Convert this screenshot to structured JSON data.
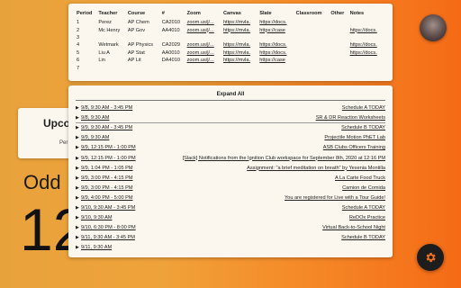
{
  "background": {
    "card_title": "Upco",
    "card_sub": "Per",
    "odd_label": "Odd",
    "big_number": "12"
  },
  "icons": {
    "avatar": "user-avatar",
    "settings": "gear-icon"
  },
  "colors": {
    "gear": "#f07020"
  },
  "schedule": {
    "headers": [
      "Period",
      "Teacher",
      "Course",
      "#",
      "Zoom",
      "Canvas",
      "Slate",
      "Classroom",
      "Other",
      "Notes"
    ],
    "rows": [
      [
        "1",
        "Perez",
        "AP Chem",
        "CA2010",
        "zoom.us/j/...",
        "https://mvla.",
        "https://docs.",
        "",
        "",
        ""
      ],
      [
        "2",
        "Mc Henry",
        "AP Gov",
        "AA4010",
        "zoom.us/j/...",
        "https://mvla.",
        "https://case",
        "",
        "",
        "https://docs."
      ],
      [
        "3",
        "",
        "",
        "",
        "",
        "",
        "",
        "",
        "",
        ""
      ],
      [
        "4",
        "Wetmark",
        "AP Physics",
        "CA2029",
        "zoom.us/j/...",
        "https://mvla.",
        "https://docs.",
        "",
        "",
        "https://docs."
      ],
      [
        "5",
        "Liu A",
        "AP Stat",
        "AA0010",
        "zoom.us/j/...",
        "https://mvla.",
        "https://docs.",
        "",
        "",
        "https://docs."
      ],
      [
        "6",
        "Lin",
        "AP Lit",
        "DA4010",
        "zoom.us/j/...",
        "https://mvla.",
        "https://case",
        "",
        "",
        ""
      ],
      [
        "7",
        "",
        "",
        "",
        "",
        "",
        "",
        "",
        "",
        ""
      ]
    ]
  },
  "events": {
    "expand_all": "Expand All",
    "items": [
      {
        "time": "9/8, 9:30 AM - 3:45 PM",
        "title": "Schedule A TODAY",
        "sep": false
      },
      {
        "time": "9/8, 9:30 AM",
        "title": "SR & DR Reaction Worksheets",
        "sep": true
      },
      {
        "time": "9/9, 9:30 AM - 3:45 PM",
        "title": "Schedule B TODAY",
        "sep": false
      },
      {
        "time": "9/9, 9:30 AM",
        "title": "Projectile Motion PhET Lab",
        "sep": false
      },
      {
        "time": "9/9, 12:15 PM - 1:00 PM",
        "title": "ASB Clubs Officers Training",
        "sep": false
      },
      {
        "time": "9/9, 12:15 PM - 1:00 PM",
        "title": "[Slack] Notifications from the Ignition Club workspace for September 8th, 2020 at 12:16 PM",
        "sep": false
      },
      {
        "time": "9/9, 1:04 PM - 1:05 PM",
        "title": "Assignment: \"a brief meditation on breath\" by Yesenia Montilla",
        "sep": false
      },
      {
        "time": "9/9, 3:00 PM - 4:15 PM",
        "title": "A La Carte Food Truck",
        "sep": false
      },
      {
        "time": "9/9, 3:00 PM - 4:15 PM",
        "title": "Camion de Comida",
        "sep": false
      },
      {
        "time": "9/9, 4:00 PM - 5:00 PM",
        "title": "You are registered for Live with a Tour Guide!",
        "sep": false
      },
      {
        "time": "9/10, 9:30 AM - 3:45 PM",
        "title": "Schedule A TODAY",
        "sep": false
      },
      {
        "time": "9/10, 9:30 AM",
        "title": "ReDOx Practice",
        "sep": false
      },
      {
        "time": "9/10, 6:30 PM - 8:00 PM",
        "title": "Virtual Back-to-School Night",
        "sep": false
      },
      {
        "time": "9/11, 9:30 AM - 3:45 PM",
        "title": "Schedule B TODAY",
        "sep": false
      },
      {
        "time": "9/11, 9:30 AM",
        "title": "",
        "sep": false
      }
    ]
  }
}
